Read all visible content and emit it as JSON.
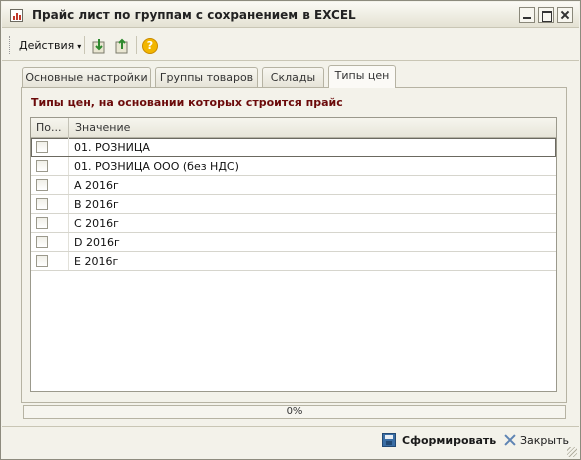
{
  "window": {
    "title": "Прайс лист по группам с сохранением в EXCEL",
    "icon": "spreadsheet-icon",
    "controls": [
      "minimize-icon",
      "maximize-icon",
      "close-icon"
    ]
  },
  "toolbar": {
    "actions_label": "Действия",
    "buttons": [
      "load-settings-icon",
      "save-settings-icon",
      "help-icon"
    ],
    "help_glyph": "?"
  },
  "tabs": [
    {
      "label": "Основные настройки",
      "active": false
    },
    {
      "label": "Группы товаров",
      "active": false
    },
    {
      "label": "Склады",
      "active": false
    },
    {
      "label": "Типы цен",
      "active": true
    }
  ],
  "price_types": {
    "heading": "Типы цен, на основании которых строится прайс",
    "columns": {
      "use": "По...",
      "value": "Значение"
    },
    "rows": [
      {
        "checked": false,
        "value": "01. РОЗНИЦА"
      },
      {
        "checked": false,
        "value": "01. РОЗНИЦА ООО (без НДС)"
      },
      {
        "checked": false,
        "value": "A 2016г"
      },
      {
        "checked": false,
        "value": "B 2016г"
      },
      {
        "checked": false,
        "value": "C 2016г"
      },
      {
        "checked": false,
        "value": "D 2016г"
      },
      {
        "checked": false,
        "value": "E 2016г"
      }
    ]
  },
  "progress": {
    "value": 0,
    "label": "0%"
  },
  "footer": {
    "generate_label": "Сформировать",
    "close_label": "Закрыть"
  },
  "colors": {
    "heading": "#6b0a0a",
    "background": "#f3f2ea",
    "grid_background": "#ffffff"
  }
}
